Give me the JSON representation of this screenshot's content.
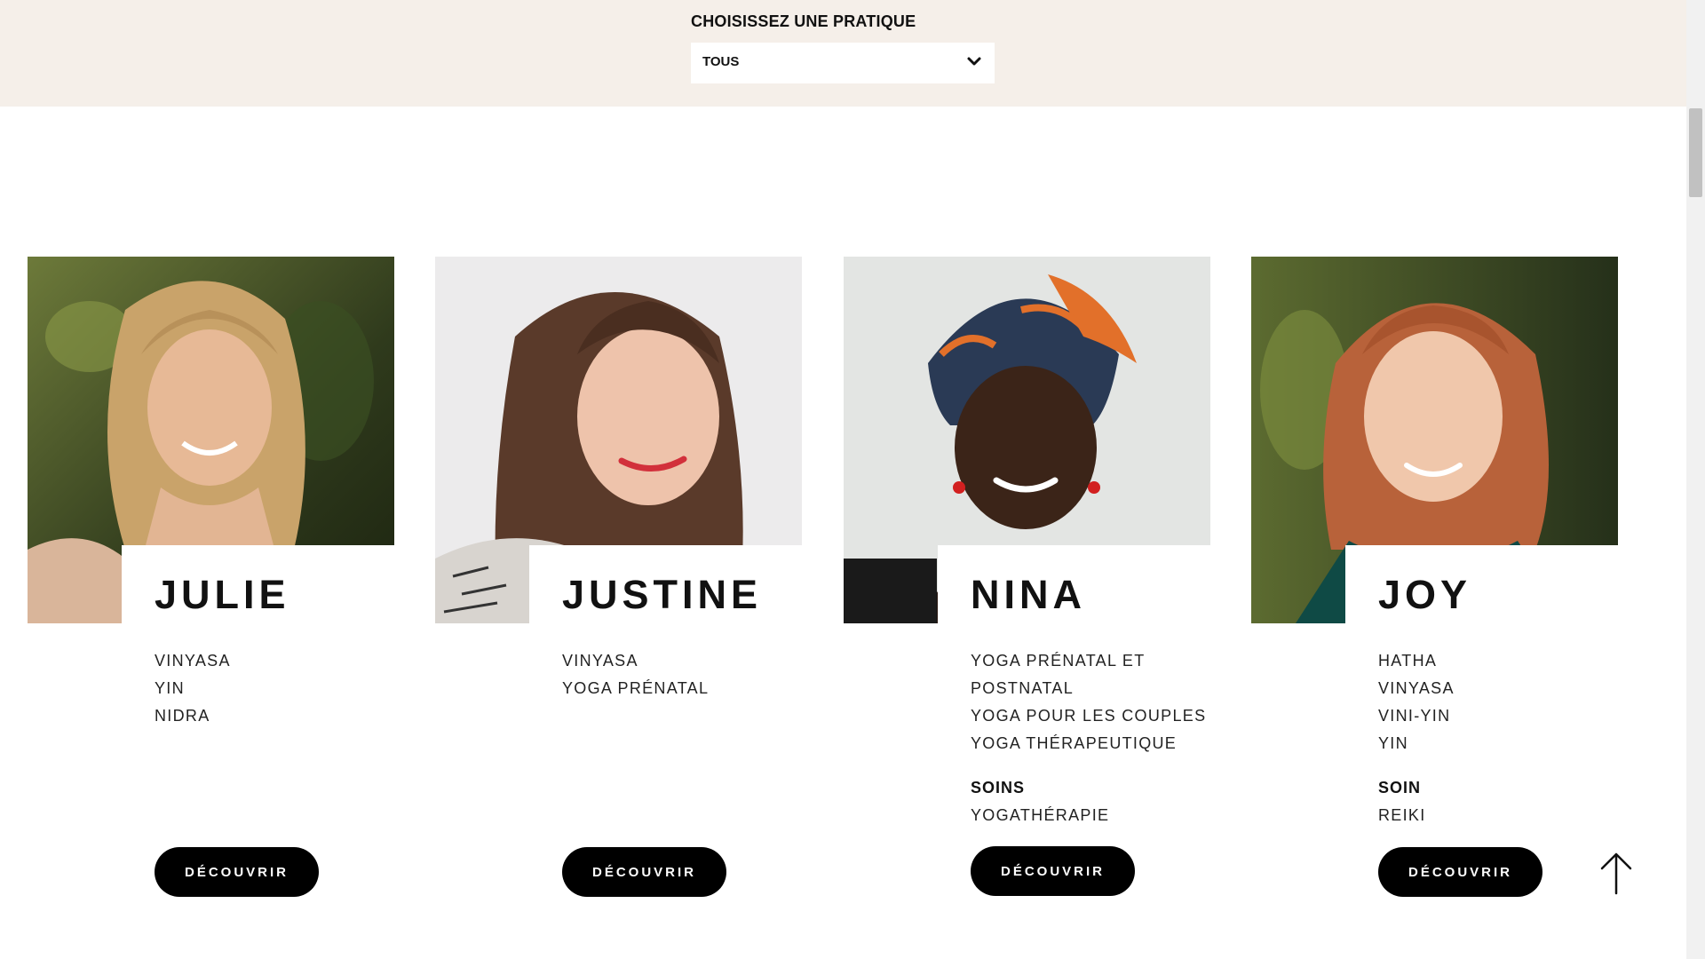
{
  "filter": {
    "label": "CHOISISSEZ UNE PRATIQUE",
    "selected": "TOUS"
  },
  "teachers": [
    {
      "name": "JULIE",
      "practices": [
        "VINYASA",
        "YIN",
        "NIDRA"
      ],
      "cta": "DÉCOUVRIR"
    },
    {
      "name": "JUSTINE",
      "practices": [
        "VINYASA",
        "YOGA PRÉNATAL"
      ],
      "cta": "DÉCOUVRIR"
    },
    {
      "name": "NINA",
      "practices": [
        "YOGA PRÉNATAL ET",
        "POSTNATAL",
        "YOGA POUR LES COUPLES",
        "YOGA THÉRAPEUTIQUE"
      ],
      "soins_title": "SOINS",
      "soins": [
        "YOGATHÉRAPIE"
      ],
      "cta": "DÉCOUVRIR"
    },
    {
      "name": "JOY",
      "practices": [
        "HATHA",
        "VINYASA",
        "VINI-YIN",
        "YIN"
      ],
      "soins_title": "SOIN",
      "soins": [
        "REIKI"
      ],
      "cta": "DÉCOUVRIR"
    }
  ],
  "icons": {
    "dropdown": "chevron-down-icon",
    "back_to_top": "arrow-up-icon"
  },
  "colors": {
    "filter_background": "#f5efe9",
    "button": "#000000",
    "button_text": "#ffffff"
  }
}
